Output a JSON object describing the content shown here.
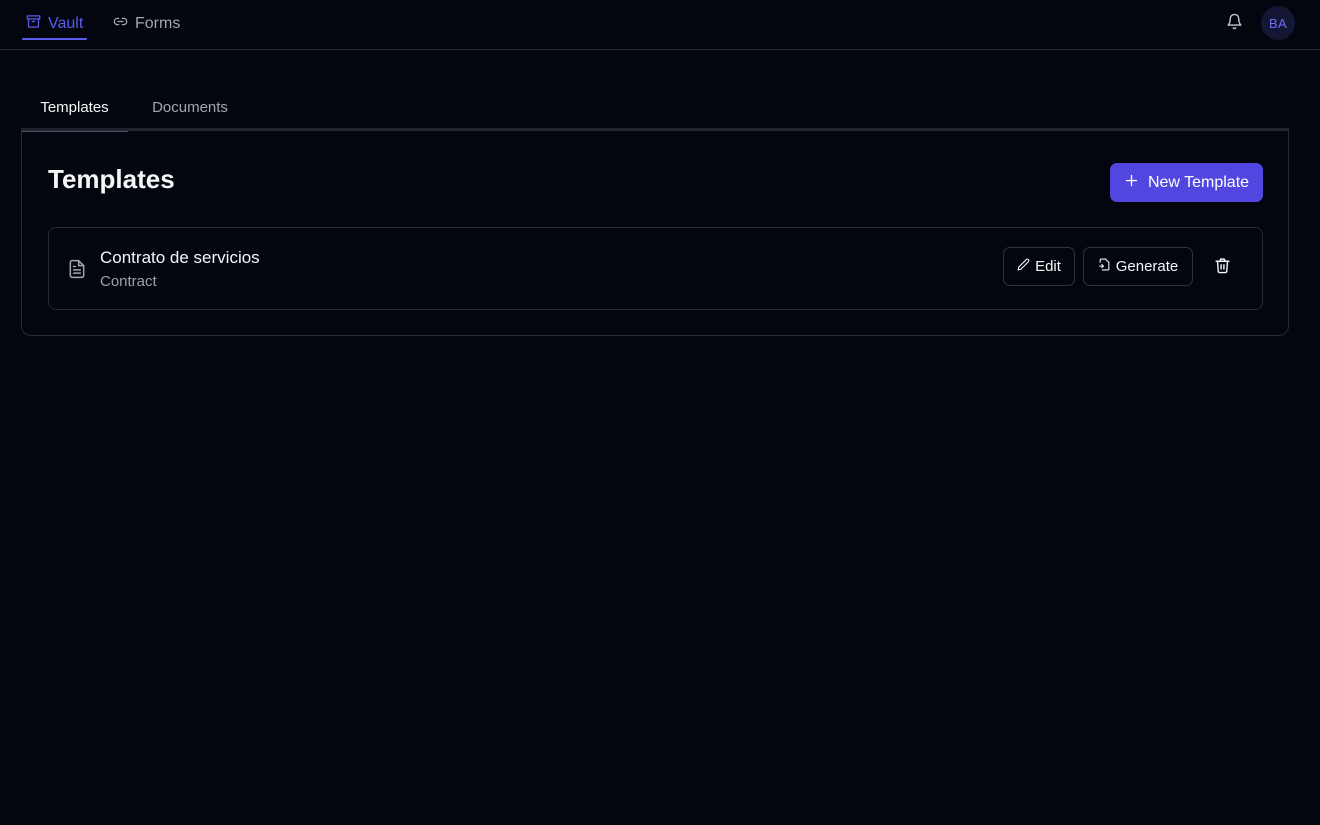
{
  "nav": {
    "items": [
      {
        "label": "Vault",
        "icon": "archive-icon",
        "active": true
      },
      {
        "label": "Forms",
        "icon": "link-icon",
        "active": false
      }
    ],
    "notifications_icon": "bell-icon",
    "avatar_initials": "BA"
  },
  "tabs": [
    {
      "label": "Templates",
      "active": true
    },
    {
      "label": "Documents",
      "active": false
    }
  ],
  "panel": {
    "title": "Templates",
    "new_button_label": "New Template"
  },
  "templates": [
    {
      "name": "Contrato de servicios",
      "type": "Contract",
      "edit_label": "Edit",
      "generate_label": "Generate"
    }
  ],
  "colors": {
    "accent": "#5b5cf0",
    "primary_button": "#5146e0",
    "background": "#04060f",
    "border": "#262a36"
  }
}
